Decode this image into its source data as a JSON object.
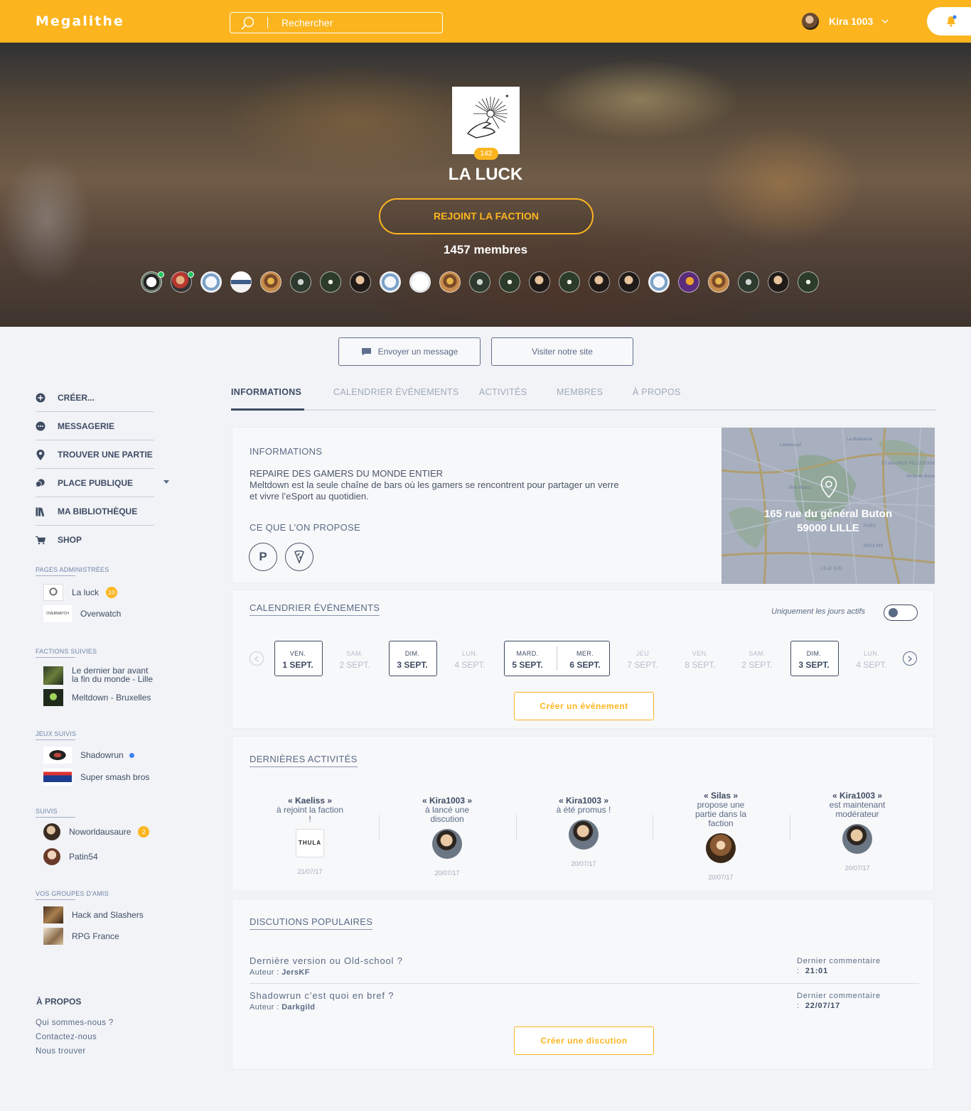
{
  "app": {
    "name": "Megalithe"
  },
  "search": {
    "placeholder": "Rechercher"
  },
  "user": {
    "name": "Kira 1003"
  },
  "colors": {
    "accent": "#fcb51f",
    "primary_text": "#3f4c63",
    "online": "#22c55e"
  },
  "faction": {
    "name": "LA LUCK",
    "badge": "142",
    "join_label": "REJOINT LA FACTION",
    "members_label": "1457 membres"
  },
  "actions": {
    "message_label": "Envoyer un message",
    "site_label": "Visiter notre site"
  },
  "sidebar": {
    "nav": [
      {
        "label": "CRÉER...",
        "icon": "plus-circle-icon"
      },
      {
        "label": "MESSAGERIE",
        "icon": "chat-icon"
      },
      {
        "label": "TROUVER UNE PARTIE",
        "icon": "map-pin-icon"
      },
      {
        "label": "PLACE PUBLIQUE",
        "icon": "discussion-icon"
      },
      {
        "label": "MA BIBLIOTHÈQUE",
        "icon": "library-icon"
      },
      {
        "label": "SHOP",
        "icon": "cart-icon"
      }
    ],
    "admin_pages": {
      "title": "PAGES ADMINISTRÉES",
      "items": [
        {
          "label": "La luck",
          "count": "10"
        },
        {
          "label": "Overwatch",
          "logo_text": "OVERWATCH"
        }
      ]
    },
    "factions": {
      "title": "FACTIONS SUIVIES",
      "items": [
        {
          "label": "Le dernier bar avant la fin du monde - Lille"
        },
        {
          "label": "Meltdown - Bruxelles"
        }
      ]
    },
    "games": {
      "title": "JEUX SUIVIS",
      "items": [
        {
          "label": "Shadowrun"
        },
        {
          "label": "Super smash bros"
        }
      ]
    },
    "followed": {
      "title": "SUIVIS",
      "items": [
        {
          "label": "Noworldausaure",
          "count": "2"
        },
        {
          "label": "Patin54"
        }
      ]
    },
    "groups": {
      "title": "VOS GROUPES D'AMIS",
      "items": [
        {
          "label": "Hack and Slashers"
        },
        {
          "label": "RPG France"
        }
      ]
    },
    "about": {
      "title": "À PROPOS",
      "links": [
        "Qui sommes-nous ?",
        "Contactez-nous",
        "Nous trouver"
      ]
    }
  },
  "tabs": [
    "INFORMATIONS",
    "CALENDRIER ÉVÉNEMENTS",
    "ACTIVITÉS",
    "MEMBRES",
    "À PROPOS"
  ],
  "info": {
    "title": "INFORMATIONS",
    "headline": "REPAIRE DES GAMERS DU MONDE ENTIER",
    "description": "Meltdown est la seule chaîne de bars où les gamers se rencontrent pour partager un verre et vivre l’eSport au quotidien.",
    "offer_title": "CE QUE L’ON PROPOSE",
    "offers": [
      {
        "label": "P",
        "icon": "parking-icon"
      },
      {
        "icon": "pizza-icon"
      }
    ],
    "address_line1": "165 rue du général Buton",
    "address_line2": "59000 LILLE"
  },
  "calendar": {
    "title": "CALENDRIER ÉVÉNEMENTS",
    "toggle_label": "Uniquement les jours actifs",
    "toggle_on": false,
    "days": [
      {
        "name": "VEN.",
        "date": "1 SEPT.",
        "active": true
      },
      {
        "name": "SAM.",
        "date": "2 SEPT.",
        "active": false
      },
      {
        "name": "DIM.",
        "date": "3 SEPT.",
        "active": true
      },
      {
        "name": "LUN.",
        "date": "4 SEPT.",
        "active": false
      },
      {
        "name": "MARD.",
        "date": "5 SEPT.",
        "active": true
      },
      {
        "name": "MER.",
        "date": "6 SEPT.",
        "active": true
      },
      {
        "name": "JEU",
        "date": "7 SEPT.",
        "active": false
      },
      {
        "name": "VEN.",
        "date": "8 SEPT.",
        "active": false
      },
      {
        "name": "SAM.",
        "date": "2 SEPT.",
        "active": false
      },
      {
        "name": "DIM.",
        "date": "3 SEPT.",
        "active": true
      },
      {
        "name": "LUN.",
        "date": "4 SEPT.",
        "active": false
      }
    ],
    "create_label": "Créer un événement"
  },
  "activities": {
    "title": "DERNIÈRES ACTIVITÉS",
    "items": [
      {
        "user": "« Kaeliss »",
        "text": "à rejoint la faction !",
        "date": "21/07/17"
      },
      {
        "user": "« Kira1003 »",
        "text": "à lancé une discution",
        "date": "20/07/17"
      },
      {
        "user": "« Kira1003 »",
        "text": "à été promus !",
        "date": "20/07/17"
      },
      {
        "user": "« Silas »",
        "text": "propose une partie dans la faction",
        "date": "20/07/17"
      },
      {
        "user": "« Kira1003 »",
        "text": "est maintenant modérateur",
        "date": "20/07/17"
      }
    ],
    "first_thumb_text": "THULA"
  },
  "discussions": {
    "title": "DISCUTIONS POPULAIRES",
    "author_prefix": "Auteur :",
    "last_comment_label": "Dernier commentaire :",
    "items": [
      {
        "title": "Dernière version ou Old-school ?",
        "author": "JersKF",
        "last": "21:01"
      },
      {
        "title": "Shadowrun c’est quoi en bref ?",
        "author": "Darkgild",
        "last": "22/07/17"
      }
    ],
    "create_label": "Créer une discution"
  }
}
